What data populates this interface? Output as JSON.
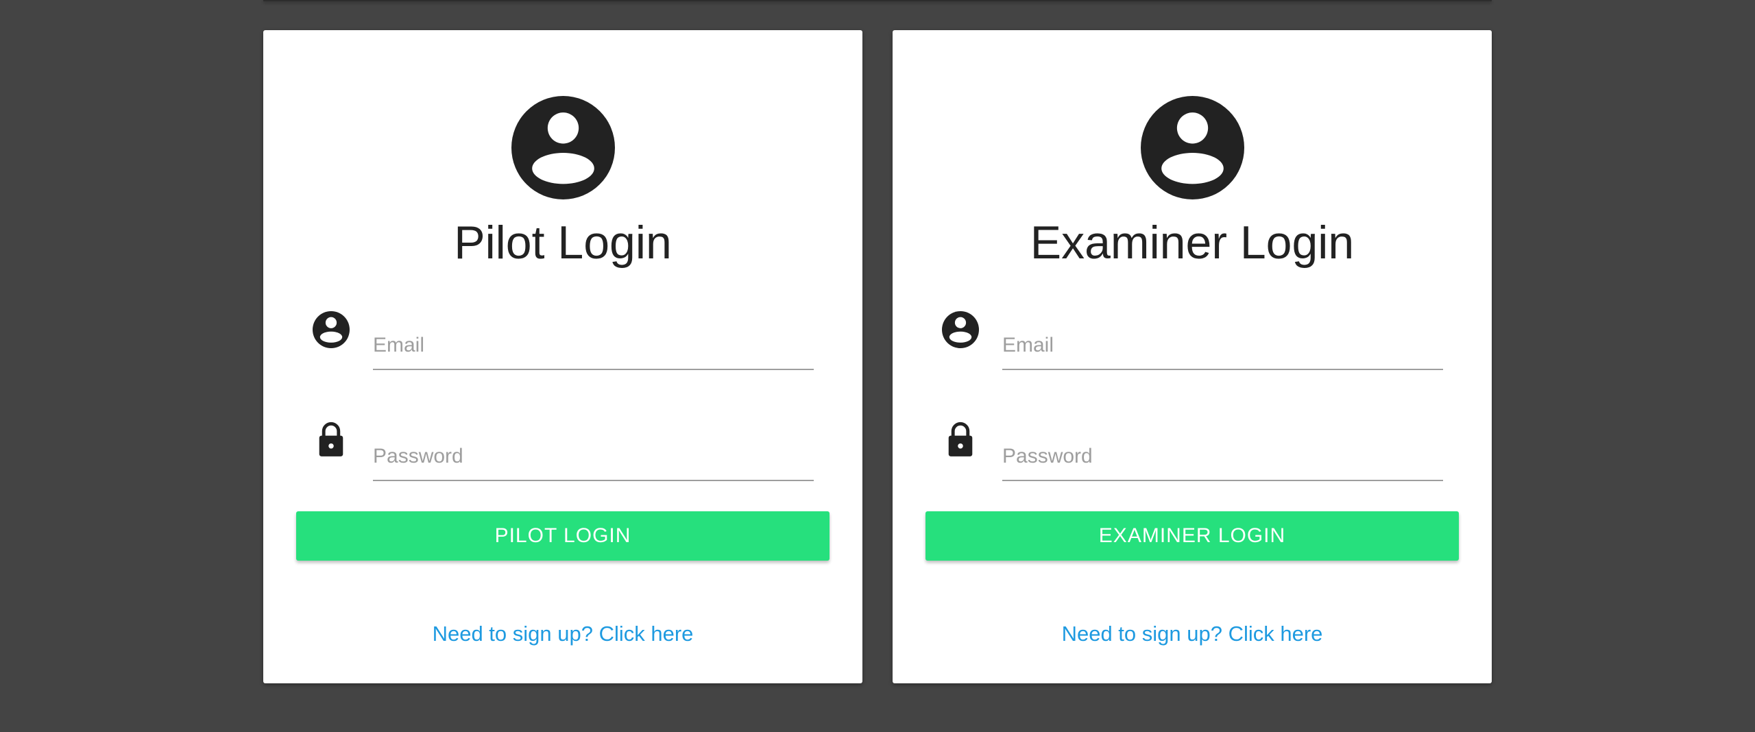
{
  "colors": {
    "background": "#444444",
    "card": "#ffffff",
    "accent_button": "#26e07d",
    "link": "#1e9ae0",
    "icon": "#222222"
  },
  "pilot": {
    "avatar_icon": "account-circle-icon",
    "title": "Pilot Login",
    "email_icon": "account-circle-icon",
    "email_placeholder": "Email",
    "email_value": "",
    "password_icon": "lock-icon",
    "password_placeholder": "Password",
    "password_value": "",
    "button_label": "PILOT LOGIN",
    "signup_link": "Need to sign up? Click here"
  },
  "examiner": {
    "avatar_icon": "account-circle-icon",
    "title": "Examiner Login",
    "email_icon": "account-circle-icon",
    "email_placeholder": "Email",
    "email_value": "",
    "password_icon": "lock-icon",
    "password_placeholder": "Password",
    "password_value": "",
    "button_label": "EXAMINER LOGIN",
    "signup_link": "Need to sign up? Click here"
  }
}
